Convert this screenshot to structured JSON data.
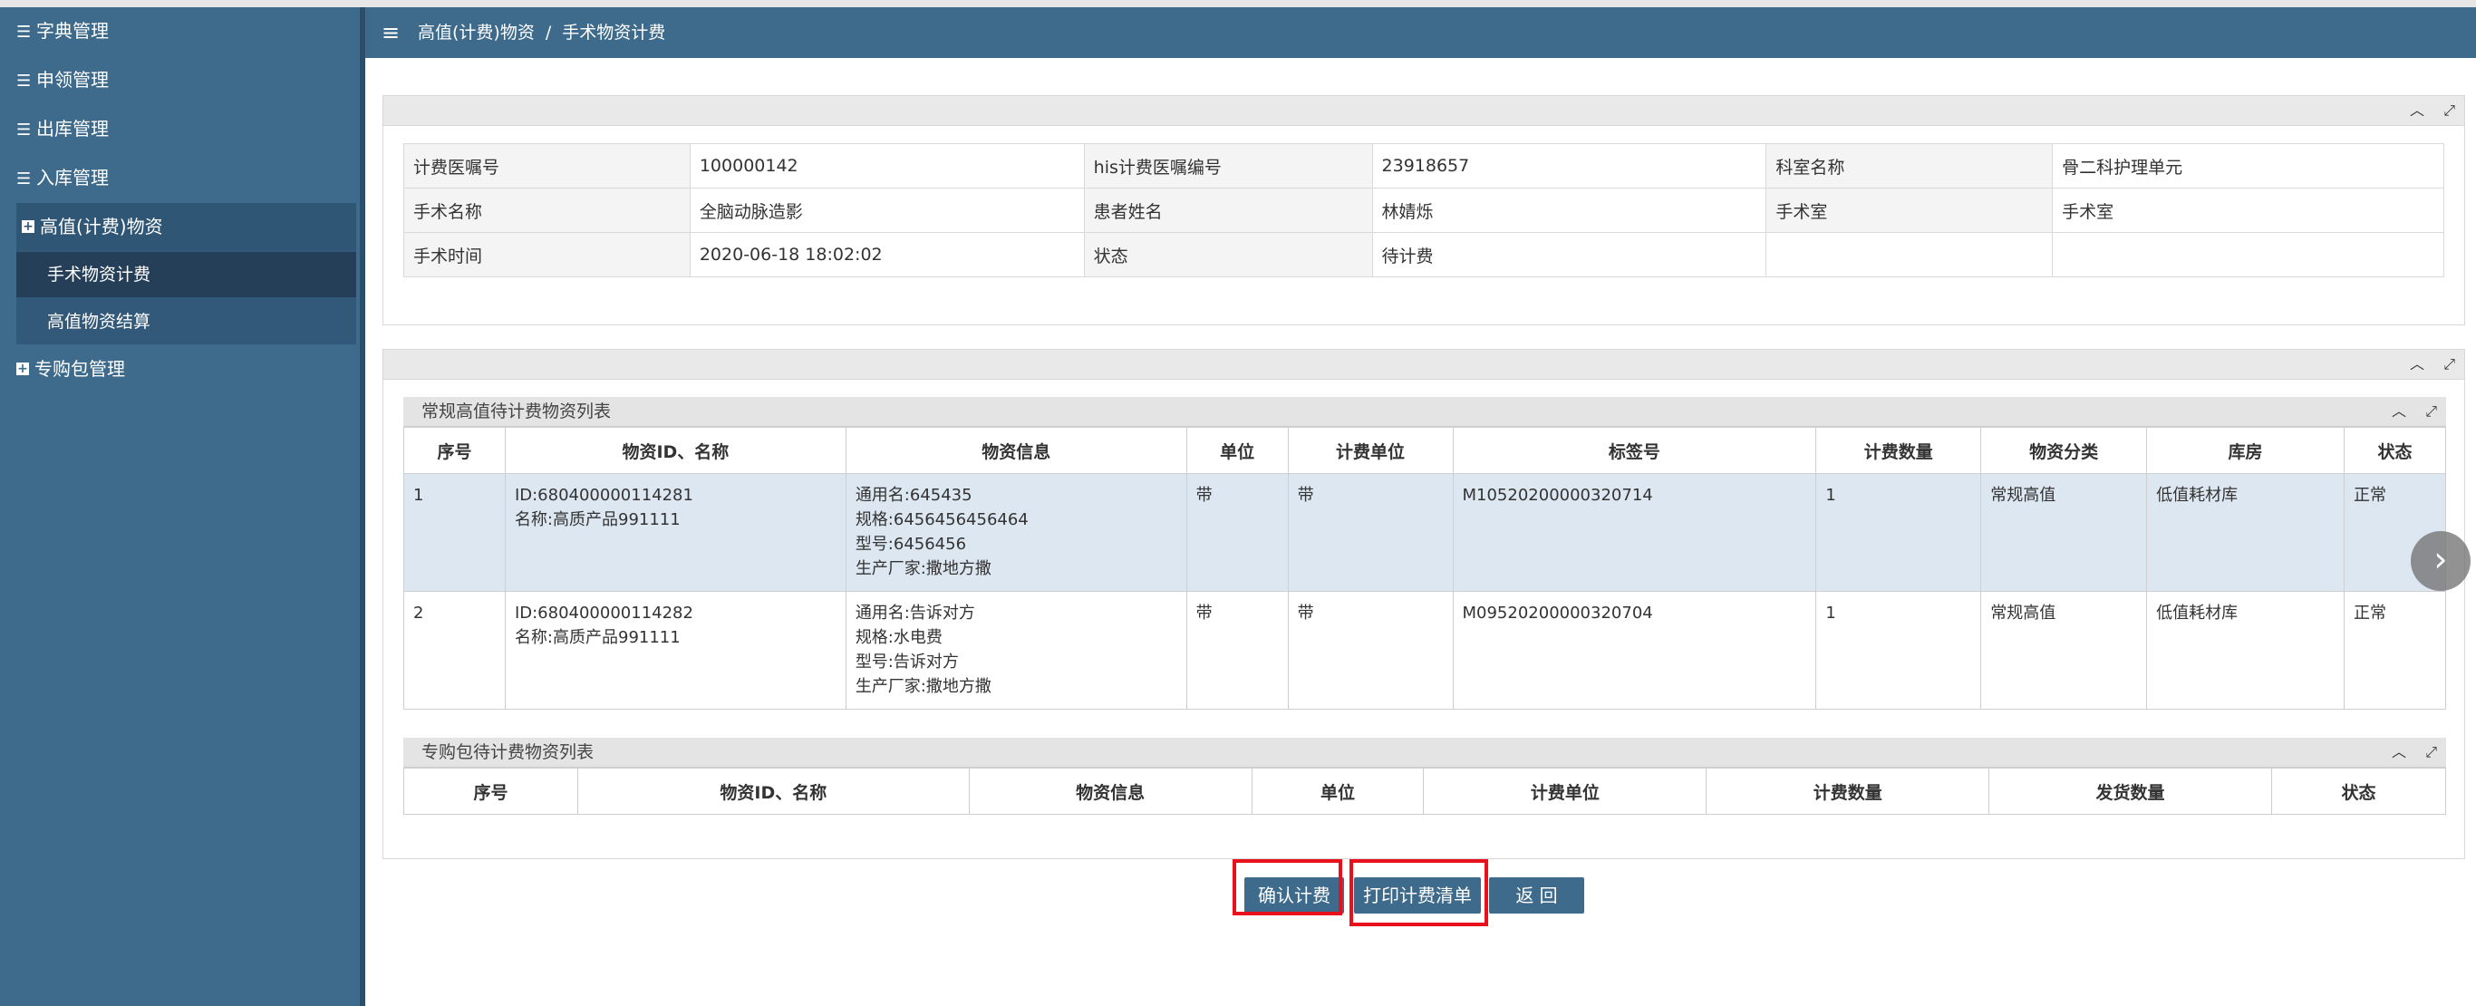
{
  "sidebar": {
    "items": [
      {
        "label": "字典管理"
      },
      {
        "label": "申领管理"
      },
      {
        "label": "出库管理"
      },
      {
        "label": "入库管理"
      }
    ],
    "group": {
      "label": "高值(计费)物资",
      "children": [
        {
          "label": "手术物资计费",
          "active": true
        },
        {
          "label": "高值物资结算",
          "active": false
        }
      ]
    },
    "group2": {
      "label": "专购包管理"
    }
  },
  "topbar": {
    "breadcrumb": [
      "高值(计费)物资",
      "手术物资计费"
    ],
    "separator": "/"
  },
  "info": {
    "rows": [
      [
        {
          "label": "计费医嘱号",
          "value": "100000142"
        },
        {
          "label": "his计费医嘱编号",
          "value": "23918657"
        },
        {
          "label": "科室名称",
          "value": "骨二科护理单元"
        }
      ],
      [
        {
          "label": "手术名称",
          "value": "全脑动脉造影"
        },
        {
          "label": "患者姓名",
          "value": "林婧烁"
        },
        {
          "label": "手术室",
          "value": "手术室"
        }
      ],
      [
        {
          "label": "手术时间",
          "value": "2020-06-18 18:02:02"
        },
        {
          "label": "状态",
          "value": "待计费"
        },
        {
          "label": "",
          "value": ""
        }
      ]
    ]
  },
  "regular_list": {
    "title": "常规高值待计费物资列表",
    "columns": [
      "序号",
      "物资ID、名称",
      "物资信息",
      "单位",
      "计费单位",
      "标签号",
      "计费数量",
      "物资分类",
      "库房",
      "状态"
    ],
    "rows": [
      {
        "no": "1",
        "id": "ID:680400000114281",
        "name": "名称:高质产品991111",
        "info": [
          "通用名:645435",
          "规格:6456456456464",
          "型号:6456456",
          "生产厂家:撒地方撒"
        ],
        "unit": "带",
        "bill_unit": "带",
        "tag": "M10520200000320714",
        "qty": "1",
        "category": "常规高值",
        "store": "低值耗材库",
        "status": "正常",
        "selected": true
      },
      {
        "no": "2",
        "id": "ID:680400000114282",
        "name": "名称:高质产品991111",
        "info": [
          "通用名:告诉对方",
          "规格:水电费",
          "型号:告诉对方",
          "生产厂家:撒地方撒"
        ],
        "unit": "带",
        "bill_unit": "带",
        "tag": "M09520200000320704",
        "qty": "1",
        "category": "常规高值",
        "store": "低值耗材库",
        "status": "正常",
        "selected": false
      }
    ]
  },
  "package_list": {
    "title": "专购包待计费物资列表",
    "columns": [
      "序号",
      "物资ID、名称",
      "物资信息",
      "单位",
      "计费单位",
      "计费数量",
      "发货数量",
      "状态"
    ]
  },
  "buttons": {
    "confirm": "确认计费",
    "print": "打印计费清单",
    "back": "返 回"
  },
  "icons": {
    "menu": "hamburger-icon",
    "collapse": "chevron-up-icon",
    "expand": "expand-icon",
    "next": "chevron-right-icon"
  },
  "colors": {
    "sidebar": "#3e6a8b",
    "button": "#3e6a8b",
    "highlight": "#e8101a",
    "selected_row": "#dde7f1"
  }
}
